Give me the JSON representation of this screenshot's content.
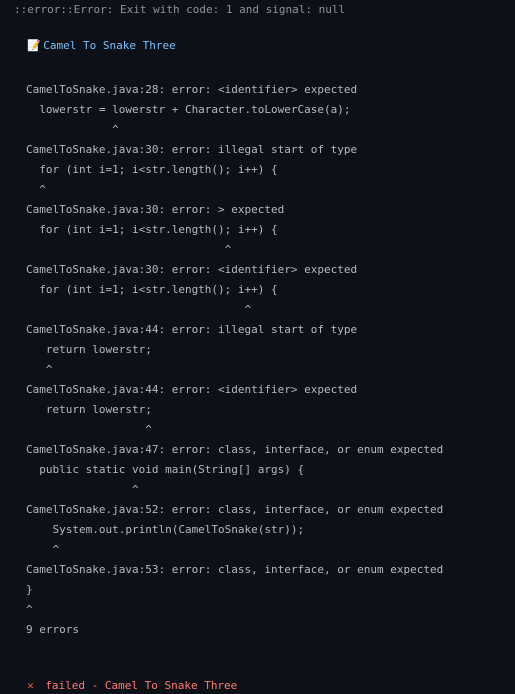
{
  "header": {
    "error_line": "::error::Error: Exit with code: 1 and signal: null",
    "step_icon": "memo-icon",
    "step_title": "Camel To Snake Three"
  },
  "log": [
    "CamelToSnake.java:28: error: <identifier> expected",
    "  lowerstr = lowerstr + Character.toLowerCase(a);",
    "             ^",
    "CamelToSnake.java:30: error: illegal start of type",
    "  for (int i=1; i<str.length(); i++) {",
    "  ^",
    "CamelToSnake.java:30: error: > expected",
    "  for (int i=1; i<str.length(); i++) {",
    "                              ^",
    "CamelToSnake.java:30: error: <identifier> expected",
    "  for (int i=1; i<str.length(); i++) {",
    "                                 ^",
    "CamelToSnake.java:44: error: illegal start of type",
    "   return lowerstr;",
    "   ^",
    "CamelToSnake.java:44: error: <identifier> expected",
    "   return lowerstr;",
    "                  ^",
    "CamelToSnake.java:47: error: class, interface, or enum expected",
    "  public static void main(String[] args) {",
    "                ^",
    "CamelToSnake.java:52: error: class, interface, or enum expected",
    "    System.out.println(CamelToSnake(str));",
    "    ^",
    "CamelToSnake.java:53: error: class, interface, or enum expected",
    "}",
    "^",
    "9 errors"
  ],
  "footer": {
    "status_icon": "cross-icon",
    "status_text": "failed - Camel To Snake Three"
  },
  "colors": {
    "background": "#0d1117",
    "error": "#ff7b72",
    "title": "#79c0ff"
  }
}
